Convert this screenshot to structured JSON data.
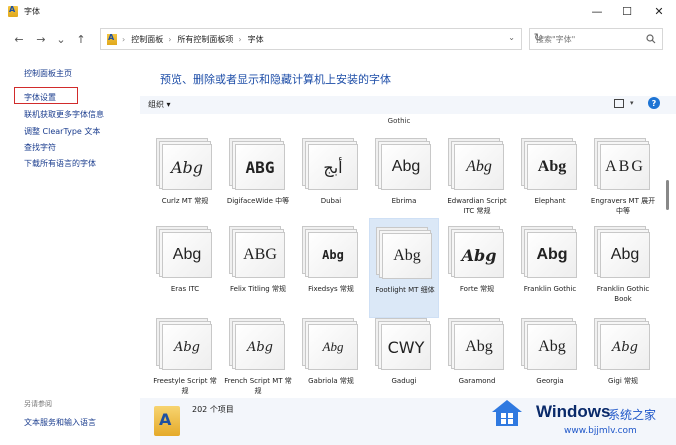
{
  "window": {
    "title": "字体",
    "minimize": "—",
    "maximize": "☐",
    "close": "✕"
  },
  "nav": {
    "back": "←",
    "forward": "→",
    "recent": "⌄",
    "up": "↑"
  },
  "address": {
    "crumbs": [
      "控制面板",
      "所有控制面板项",
      "字体"
    ],
    "separator": "›",
    "dropdown": "⌄",
    "refresh": "↻"
  },
  "search": {
    "placeholder": "搜索\"字体\"",
    "icon": "search-icon"
  },
  "sidebar": {
    "items": [
      "控制面板主页",
      "字体设置",
      "联机获取更多字体信息",
      "调整 ClearType 文本",
      "查找字符",
      "下载所有语言的字体"
    ],
    "highlighted_item": "字体设置",
    "see_also": {
      "heading": "另请参阅",
      "items": [
        "文本服务和输入语言"
      ]
    }
  },
  "main": {
    "heading": "预览、删除或者显示和隐藏计算机上安装的字体",
    "toolbar": {
      "organize": "组织 ▾",
      "help": "?"
    },
    "top_partial": {
      "label": "Gothic"
    },
    "fonts": [
      {
        "sample": "Abg",
        "label": "Curlz MT 常规"
      },
      {
        "sample": "ABG",
        "label": "DigifaceWide 中等"
      },
      {
        "sample": "أبج",
        "label": "Dubai"
      },
      {
        "sample": "Abg",
        "label": "Ebrima"
      },
      {
        "sample": "Abg",
        "label": "Edwardian Script ITC 常规"
      },
      {
        "sample": "Abg",
        "label": "Elephant"
      },
      {
        "sample": "ABG",
        "label": "Engravers MT 展开 中等"
      },
      {
        "sample": "Abg",
        "label": "Eras ITC"
      },
      {
        "sample": "ABG",
        "label": "Felix Titling 常规"
      },
      {
        "sample": "Abg",
        "label": "Fixedsys 常规"
      },
      {
        "sample": "Abg",
        "label": "Footlight MT 细体",
        "selected": true
      },
      {
        "sample": "Abg",
        "label": "Forte 常规"
      },
      {
        "sample": "Abg",
        "label": "Franklin Gothic"
      },
      {
        "sample": "Abg",
        "label": "Franklin Gothic Book"
      },
      {
        "sample": "Abg",
        "label": "Freestyle Script 常规"
      },
      {
        "sample": "Abg",
        "label": "French Script MT 常规"
      },
      {
        "sample": "Abg",
        "label": "Gabriola 常规"
      },
      {
        "sample": "CWY",
        "label": "Gadugi"
      },
      {
        "sample": "Abg",
        "label": "Garamond"
      },
      {
        "sample": "Abg",
        "label": "Georgia"
      },
      {
        "sample": "Abg",
        "label": "Gigi 常规"
      }
    ]
  },
  "status": {
    "count": "202 个项目"
  },
  "watermark": {
    "brand": "Windows",
    "site_name": "系统之家",
    "url": "www.bjjmlv.com"
  }
}
